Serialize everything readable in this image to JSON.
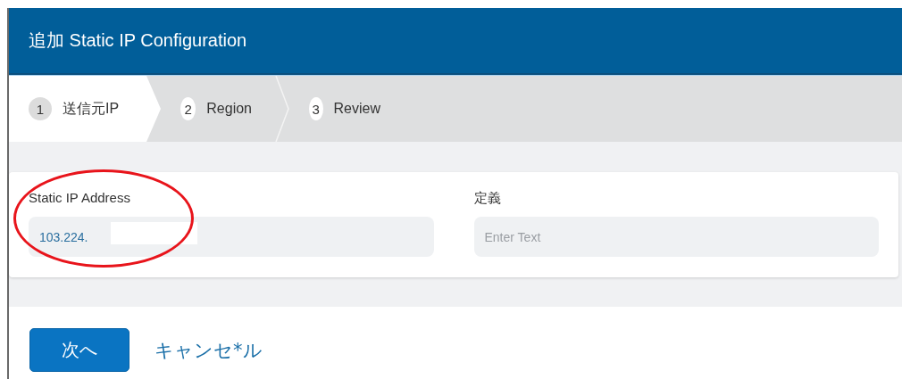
{
  "dialog": {
    "title": "追加 Static IP Configuration"
  },
  "steps": [
    {
      "number": "1",
      "label": "送信元IP",
      "selected": true
    },
    {
      "number": "2",
      "label": "Region",
      "selected": false
    },
    {
      "number": "3",
      "label": "Review",
      "selected": false
    }
  ],
  "fields": [
    {
      "label": "Static IP Address",
      "value": "103.224.",
      "redacted": true,
      "highlighted": true
    },
    {
      "label": "定義",
      "placeholder": "Enter Text",
      "redacted": false,
      "highlighted": false
    }
  ],
  "buttons": [
    {
      "kind": "primary",
      "label": "次へ"
    },
    {
      "kind": "link",
      "label": "キャンセ*ル"
    }
  ]
}
